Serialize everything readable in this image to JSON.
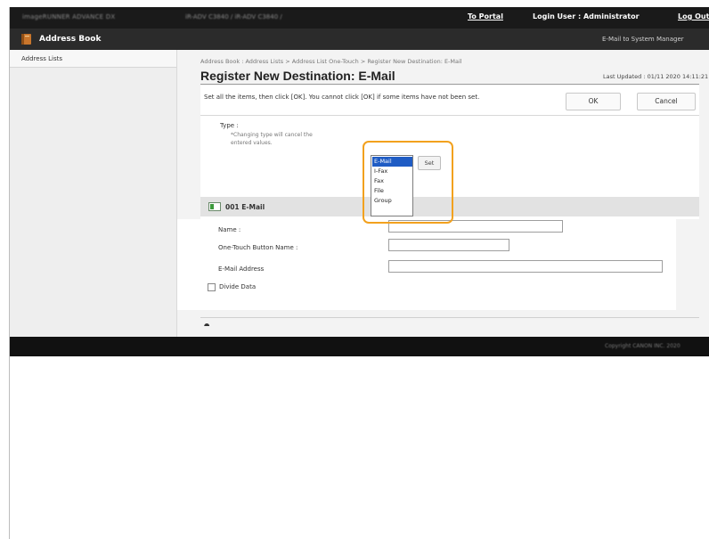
{
  "topbar": {
    "device_name": "imageRUNNER ADVANCE DX",
    "host_address": "iR-ADV C3840 / iR-ADV C3840 /",
    "portal_link": "To Portal",
    "login_user": "Login User : Administrator",
    "logout_link": "Log Out"
  },
  "header": {
    "app_title": "Address Book",
    "email_link": "E-Mail to System Manager"
  },
  "sidebar": {
    "items": [
      {
        "label": "Address Lists"
      }
    ]
  },
  "breadcrumb": "Address Book : Address Lists > Address List One-Touch > Register New Destination: E-Mail",
  "page_title": "Register New Destination: E-Mail",
  "last_updated": "Last Updated : 01/11 2020 14:11:21",
  "instruction": "Set all the items, then click [OK]. You cannot click [OK] if some items have not been set.",
  "buttons": {
    "ok": "OK",
    "cancel": "Cancel",
    "set": "Set"
  },
  "type_field": {
    "label": "Type :",
    "note": "*Changing type will cancel the entered values.",
    "options": [
      "E-Mail",
      "I-Fax",
      "Fax",
      "File",
      "Group"
    ],
    "selected": "E-Mail"
  },
  "section": {
    "title": "001 E-Mail"
  },
  "fields": {
    "name_label": "Name :",
    "name_value": "",
    "onetouch_label": "One-Touch Button Name :",
    "onetouch_value": "",
    "email_label": "E-Mail Address",
    "email_value": "",
    "divide_label": "Divide Data",
    "divide_checked": false
  },
  "top_icon": "⯊",
  "footer": {
    "copyright": "Copyright CANON INC. 2020"
  },
  "colors": {
    "highlight": "#f2a11e",
    "selected_option": "#1f5cc4",
    "topbar": "#1a1a1a"
  }
}
